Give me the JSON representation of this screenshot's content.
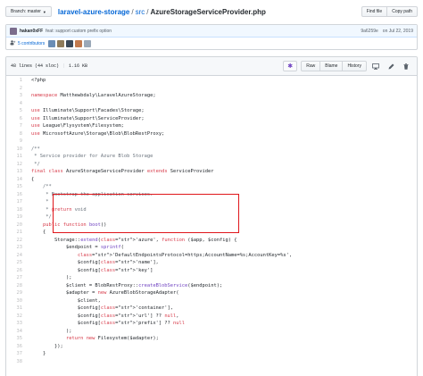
{
  "topbar": {
    "branch_label": "Branch: master",
    "repo": "laravel-azure-storage",
    "sep1": "/",
    "dir": "src",
    "sep2": "/",
    "file": "AzureStorageServiceProvider.php",
    "find_file": "Find file",
    "copy_path": "Copy path"
  },
  "commit": {
    "author": "hakan0xFF",
    "message": "feat: support custom prefix option",
    "sha": "9a6259e",
    "date": "on Jul 22, 2019"
  },
  "contributors": {
    "label": "5 contributors",
    "avatar_colors": [
      "#6a8db5",
      "#8e7b5a",
      "#3b4a5a",
      "#c27a4e",
      "#9aa8b8"
    ]
  },
  "file_header": {
    "lines": "48 lines (44 sloc)",
    "size": "1.16 KB",
    "raw": "Raw",
    "blame": "Blame",
    "history": "History",
    "icons": [
      "sparkle-icon",
      "desktop-icon",
      "pencil-icon",
      "trash-icon"
    ]
  },
  "code_lines": [
    {
      "n": "1",
      "t": "<?php"
    },
    {
      "n": "2",
      "t": ""
    },
    {
      "n": "3",
      "t": "namespace Matthewbdaly\\LaravelAzureStorage;"
    },
    {
      "n": "4",
      "t": ""
    },
    {
      "n": "5",
      "t": "use Illuminate\\Support\\Facades\\Storage;"
    },
    {
      "n": "6",
      "t": "use Illuminate\\Support\\ServiceProvider;"
    },
    {
      "n": "7",
      "t": "use League\\Flysystem\\Filesystem;"
    },
    {
      "n": "8",
      "t": "use MicrosoftAzure\\Storage\\Blob\\BlobRestProxy;"
    },
    {
      "n": "9",
      "t": ""
    },
    {
      "n": "10",
      "t": "/**"
    },
    {
      "n": "11",
      "t": " * Service provider for Azure Blob Storage"
    },
    {
      "n": "12",
      "t": " */"
    },
    {
      "n": "13",
      "t": "final class AzureStorageServiceProvider extends ServiceProvider"
    },
    {
      "n": "14",
      "t": "{"
    },
    {
      "n": "15",
      "t": "    /**"
    },
    {
      "n": "16",
      "t": "     * Bootstrap the application services."
    },
    {
      "n": "17",
      "t": "     *"
    },
    {
      "n": "18",
      "t": "     * @return void"
    },
    {
      "n": "19",
      "t": "     */"
    },
    {
      "n": "20",
      "t": "    public function boot()"
    },
    {
      "n": "21",
      "t": "    {"
    },
    {
      "n": "22",
      "t": "        Storage::extend('azure', function ($app, $config) {"
    },
    {
      "n": "23",
      "t": "            $endpoint = sprintf("
    },
    {
      "n": "24",
      "t": "                'DefaultEndpointsProtocol=https;AccountName=%s;AccountKey=%s',"
    },
    {
      "n": "25",
      "t": "                $config['name'],"
    },
    {
      "n": "26",
      "t": "                $config['key']"
    },
    {
      "n": "27",
      "t": "            );"
    },
    {
      "n": "28",
      "t": "            $client = BlobRestProxy::createBlobService($endpoint);"
    },
    {
      "n": "29",
      "t": "            $adapter = new AzureBlobStorageAdapter("
    },
    {
      "n": "30",
      "t": "                $client,"
    },
    {
      "n": "31",
      "t": "                $config['container'],"
    },
    {
      "n": "32",
      "t": "                $config['url'] ?? null,"
    },
    {
      "n": "33",
      "t": "                $config['prefix'] ?? null"
    },
    {
      "n": "34",
      "t": "            );"
    },
    {
      "n": "35",
      "t": "            return new Filesystem($adapter);"
    },
    {
      "n": "36",
      "t": "        });"
    },
    {
      "n": "37",
      "t": "    }"
    },
    {
      "n": "38",
      "t": ""
    }
  ],
  "colors": {
    "highlight": "#e0161b",
    "link": "#0366d6"
  }
}
